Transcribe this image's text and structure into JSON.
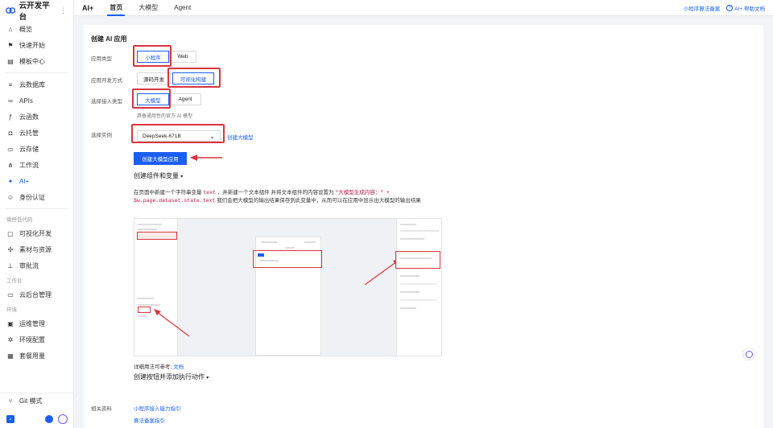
{
  "brand": {
    "title": "云开发平台"
  },
  "sidebar": {
    "items_top": [
      {
        "label": "概览",
        "icon": "home-icon"
      },
      {
        "label": "快速开始",
        "icon": "flag-icon"
      },
      {
        "label": "模板中心",
        "icon": "template-icon"
      }
    ],
    "items_mid": [
      {
        "label": "云数据库",
        "icon": "database-icon"
      },
      {
        "label": "APIs",
        "icon": "link-icon"
      },
      {
        "label": "云函数",
        "icon": "function-icon"
      },
      {
        "label": "云托管",
        "icon": "container-icon"
      },
      {
        "label": "云存储",
        "icon": "folder-icon"
      },
      {
        "label": "工作流",
        "icon": "workflow-icon"
      },
      {
        "label": "AI+",
        "icon": "ai-icon"
      },
      {
        "label": "身份认证",
        "icon": "user-icon"
      }
    ],
    "group_lowcode": "微搭低代码",
    "items_lowcode": [
      {
        "label": "可视化开发",
        "icon": "visual-dev-icon"
      },
      {
        "label": "素材与资源",
        "icon": "assets-icon"
      },
      {
        "label": "审批流",
        "icon": "approval-icon"
      }
    ],
    "group_workbench": "工作台",
    "items_workbench": [
      {
        "label": "云后台管理",
        "icon": "admin-icon"
      }
    ],
    "group_env": "环境",
    "items_env": [
      {
        "label": "运维管理",
        "icon": "ops-icon"
      },
      {
        "label": "环境配置",
        "icon": "settings-icon"
      },
      {
        "label": "套餐用量",
        "icon": "package-icon"
      }
    ],
    "git": {
      "label": "Git 模式",
      "icon": "git-icon"
    }
  },
  "topbar": {
    "app_name": "AI+",
    "tabs": [
      "首页",
      "大模型",
      "Agent"
    ],
    "right_links": [
      "小程序算法备案",
      "AI+ 帮助文档"
    ]
  },
  "main": {
    "section_title": "创建 AI 应用",
    "app_type": {
      "label": "应用类型",
      "options": [
        "小程序",
        "Web"
      ],
      "selected": "小程序"
    },
    "dev_mode": {
      "label": "应用开发方式",
      "options": [
        "源码开发",
        "可视化构建"
      ],
      "selected": "可视化构建"
    },
    "access_type": {
      "label": "选择接入类型",
      "options": [
        "大模型",
        "Agent"
      ],
      "selected": "大模型"
    },
    "access_hint": "具备通用性的官方 AI 模型",
    "instance": {
      "label": "选择实例",
      "value": "DeepSeek-671B",
      "link": "创建大模型"
    },
    "create_button": "创建大模型应用",
    "step1_title": "创建组件和变量",
    "step1_desc_1": "在页面中新建一个字符串变量",
    "step1_code_1": "text",
    "step1_desc_2": "，并新建一个文本组件 并将文本组件的内容设置为",
    "step1_code_2": "\"大模型生成内容：\" + $w.page.dataset.state.text",
    "step1_desc_3": "我们会把大模型的输出结果保存到此变量中，从而可以在应用中显示出大模型的输出结果",
    "usage_ref": "详细用法可参考:",
    "usage_link": "文档",
    "step2_title": "创建按钮并添加执行动作",
    "related_label": "相关资料",
    "related_links": [
      "小程序接入能力指引",
      "算法备案指引"
    ]
  },
  "colors": {
    "accent": "#1b5ff0",
    "highlight": "#d9363e"
  }
}
